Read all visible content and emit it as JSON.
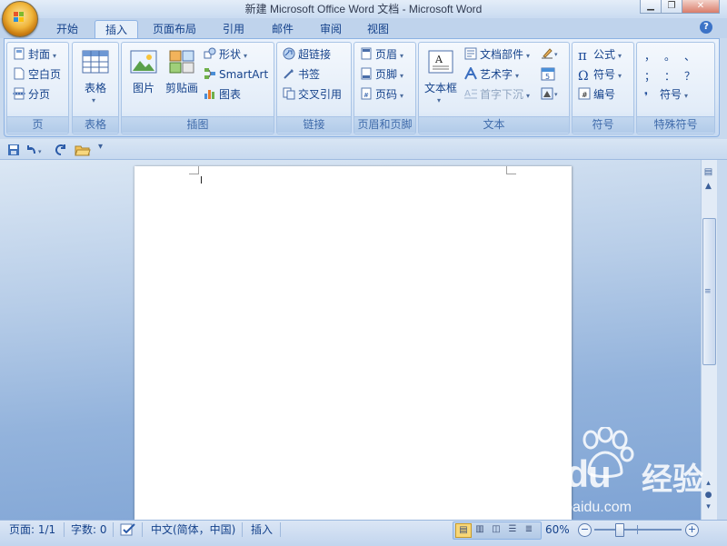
{
  "window": {
    "title": "新建 Microsoft Office Word 文档 - Microsoft Word"
  },
  "tabs": [
    "开始",
    "插入",
    "页面布局",
    "引用",
    "邮件",
    "审阅",
    "视图"
  ],
  "active_tab": "插入",
  "ribbon": {
    "pages": {
      "label": "页",
      "cover": "封面",
      "blank": "空白页",
      "break": "分页"
    },
    "tables": {
      "label": "表格",
      "table": "表格"
    },
    "illustrations": {
      "label": "插图",
      "picture": "图片",
      "clipart": "剪贴画",
      "shapes": "形状",
      "smartart": "SmartArt",
      "chart": "图表"
    },
    "links": {
      "label": "链接",
      "hyperlink": "超链接",
      "bookmark": "书签",
      "crossref": "交叉引用"
    },
    "headerfooter": {
      "label": "页眉和页脚",
      "header": "页眉",
      "footer": "页脚",
      "pagenum": "页码"
    },
    "text": {
      "label": "文本",
      "textbox": "文本框",
      "quickparts": "文档部件",
      "wordart": "艺术字",
      "dropcap": "首字下沉"
    },
    "symbols": {
      "label": "符号",
      "equation": "公式",
      "symbol": "符号",
      "number": "编号"
    },
    "special": {
      "label": "特殊符号",
      "row1": [
        "，",
        "。",
        "、"
      ],
      "row2": [
        "；",
        "：",
        "？"
      ],
      "symbol": "符号"
    }
  },
  "statusbar": {
    "page": "页面: 1/1",
    "words": "字数: 0",
    "language": "中文(简体，中国)",
    "mode": "插入",
    "zoom": "60%",
    "zoom_level": 0.6
  },
  "watermark": {
    "brand": "Baidu",
    "cn": "经验",
    "url": "jingyan.baidu.com"
  }
}
